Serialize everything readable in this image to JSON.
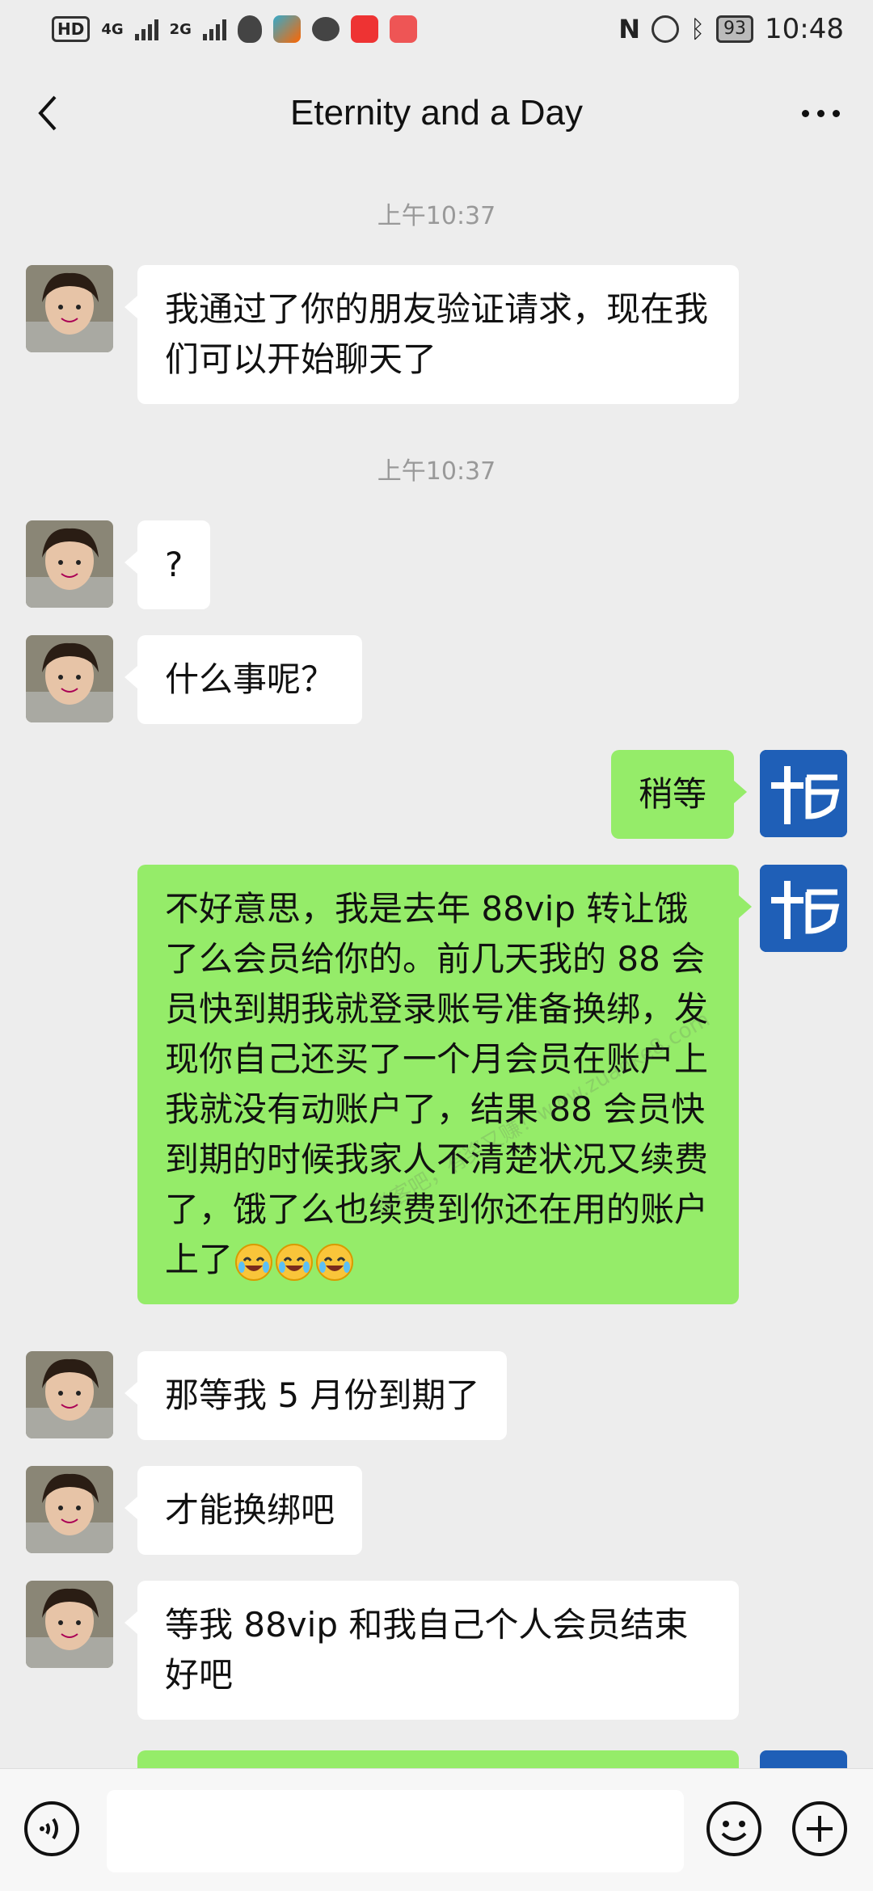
{
  "status_bar": {
    "hd": "HD",
    "net1": "4G",
    "net2": "2G",
    "battery": "93",
    "time": "10:48"
  },
  "header": {
    "title": "Eternity and a Day"
  },
  "messages": {
    "ts1": "上午10:37",
    "m1": "我通过了你的朋友验证请求，现在我们可以开始聊天了",
    "ts2": "上午10:37",
    "m2": "?",
    "m3": "什么事呢？",
    "m4": "稍等",
    "m5": "不好意思，我是去年 88vip 转让饿了么会员给你的。前几天我的 88 会员快到期我就登录账号准备换绑，发现你自己还买了一个月会员在账户上我就没有动账户了，结果 88 会员快到期的时候我家人不清楚状况又续费了，饿了么也续费到你还在用的账户上了",
    "m6": "那等我 5 月份到期了",
    "m7": "才能换绑吧",
    "m8": "等我 88vip 和我自己个人会员结束好吧"
  },
  "watermark": "赚客吧，有奖又赚！www.zuanke8.com",
  "colors": {
    "background": "#ededed",
    "bubble_sent": "#95ec69",
    "bubble_received": "#ffffff",
    "self_avatar": "#1f5fb7"
  },
  "icons": {
    "back": "chevron-left-icon",
    "more": "more-dots-icon",
    "voice": "voice-icon",
    "emoji": "smiley-icon",
    "plus": "plus-icon",
    "laugh_cry": "laugh-cry-emoji"
  }
}
